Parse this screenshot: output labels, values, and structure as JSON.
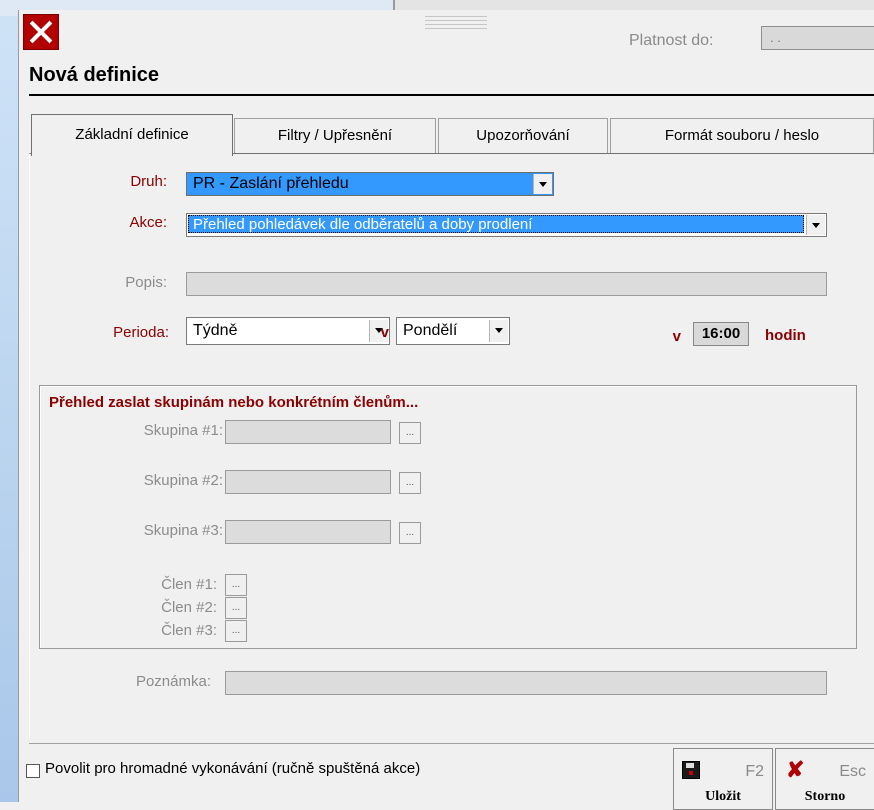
{
  "window": {
    "platnost_label": "Platnost do:",
    "platnost_value": ". .",
    "title": "Nová definice"
  },
  "tabs": [
    {
      "label": "Základní definice",
      "active": true
    },
    {
      "label": "Filtry / Upřesnění",
      "active": false
    },
    {
      "label": "Upozorňování",
      "active": false
    },
    {
      "label": "Formát souboru / heslo",
      "active": false
    }
  ],
  "form": {
    "druh_label": "Druh:",
    "druh_value": "PR - Zaslání přehledu",
    "akce_label": "Akce:",
    "akce_value": "Přehled pohledávek dle odběratelů a doby prodlení",
    "popis_label": "Popis:",
    "perioda_label": "Perioda:",
    "perioda_value": "Týdně",
    "v_label": "v",
    "den_value": "Pondělí",
    "v2_label": "v",
    "time_value": "16:00",
    "hodin_label": "hodin"
  },
  "group": {
    "title": "Přehled zaslat skupinám nebo konkrétním členům...",
    "skupina1_label": "Skupina #1:",
    "skupina2_label": "Skupina #2:",
    "skupina3_label": "Skupina #3:",
    "clen1_label": "Člen #1:",
    "clen2_label": "Člen #2:",
    "clen3_label": "Člen #3:",
    "browse": "..."
  },
  "poznamka_label": "Poznámka:",
  "footer": {
    "checkbox_label": "Povolit pro hromadné vykonávání (ručně spuštěná akce)",
    "save_key": "F2",
    "save_label": "Uložit",
    "cancel_key": "Esc",
    "cancel_label": "Storno"
  },
  "colors": {
    "accent_red": "#8b0000",
    "selection_blue": "#3399ff"
  }
}
